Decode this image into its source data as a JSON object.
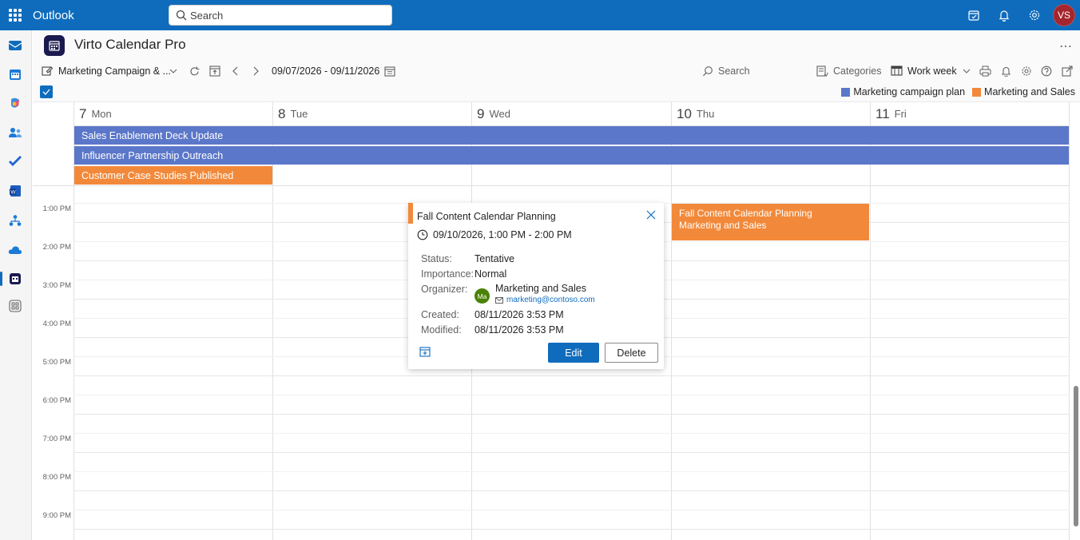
{
  "topbar": {
    "brand": "Outlook",
    "search_placeholder": "Search",
    "user_initials": "VS",
    "colors": {
      "bar": "#0f6cbd"
    }
  },
  "rail": {
    "icons": [
      "mail-icon",
      "calendar-icon",
      "copilot-icon",
      "people-icon",
      "todo-icon",
      "word-icon",
      "org-explorer-icon",
      "onedrive-icon",
      "virto-calendar-icon",
      "more-apps-icon"
    ]
  },
  "app": {
    "title": "Virto Calendar Pro"
  },
  "toolbar": {
    "calendar_name": "Marketing Campaign & ...",
    "date_range": "09/07/2026 - 09/11/2026",
    "search_label": "Search",
    "categories_label": "Categories",
    "view_label": "Work week"
  },
  "legend": [
    {
      "label": "Marketing campaign plan",
      "color": "#5b77c9"
    },
    {
      "label": "Marketing and Sales",
      "color": "#f2893a"
    }
  ],
  "days": [
    {
      "num": "7",
      "name": "Mon"
    },
    {
      "num": "8",
      "name": "Tue"
    },
    {
      "num": "9",
      "name": "Wed"
    },
    {
      "num": "10",
      "name": "Thu"
    },
    {
      "num": "11",
      "name": "Fri"
    }
  ],
  "allday_events": [
    {
      "title": "Sales Enablement Deck Update"
    },
    {
      "title": "Influencer Partnership Outreach"
    },
    {
      "title": "Customer Case Studies Published"
    }
  ],
  "times": [
    "1:00 PM",
    "2:00 PM",
    "3:00 PM",
    "4:00 PM",
    "5:00 PM",
    "6:00 PM",
    "7:00 PM",
    "8:00 PM",
    "9:00 PM"
  ],
  "timed_event": {
    "title": "Fall Content Calendar Planning",
    "calendar": "Marketing and Sales"
  },
  "popup": {
    "title": "Fall Content Calendar Planning",
    "datetime": "09/10/2026, 1:00 PM - 2:00 PM",
    "status_label": "Status:",
    "status_value": "Tentative",
    "importance_label": "Importance:",
    "importance_value": "Normal",
    "organizer_label": "Organizer:",
    "organizer_initials": "Ma",
    "organizer_name": "Marketing and Sales",
    "organizer_email": "marketing@contoso.com",
    "created_label": "Created:",
    "created_value": "08/11/2026 3:53 PM",
    "modified_label": "Modified:",
    "modified_value": "08/11/2026 3:53 PM",
    "edit_label": "Edit",
    "delete_label": "Delete"
  }
}
